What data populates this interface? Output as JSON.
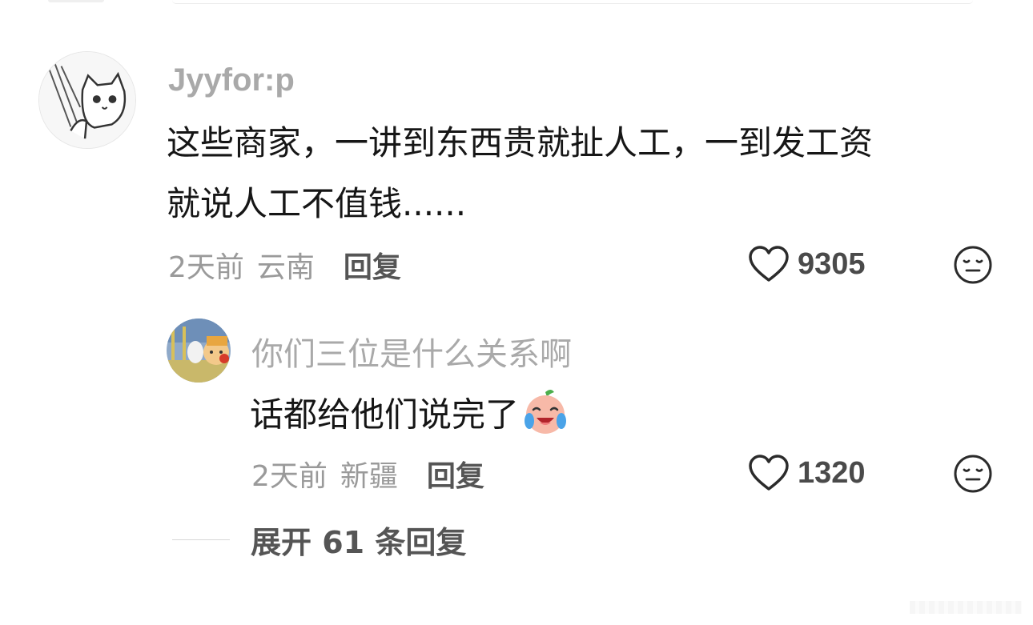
{
  "comments": [
    {
      "username": "Jyyfor:p",
      "text_lines": [
        "这些商家，一讲到东西贵就扯人工，一到发工资",
        "就说人工不值钱......"
      ],
      "time": "2天前",
      "location": "云南",
      "reply_label": "回复",
      "likes": "9305",
      "avatar_icon": "cat-sketch-avatar-icon"
    },
    {
      "username": "你们三位是什么关系啊",
      "text_lines": [
        "话都给他们说完了"
      ],
      "emoji": "laughing-crying-emoji-icon",
      "time": "2天前",
      "location": "新疆",
      "reply_label": "回复",
      "likes": "1320",
      "avatar_icon": "cartoon-avatar-icon"
    }
  ],
  "expand_label": "展开 61 条回复",
  "icons": {
    "like": "heart-outline-icon",
    "dislike": "meh-face-icon"
  },
  "colors": {
    "username": "#a9a9a9",
    "text": "#161616",
    "meta": "#9a9a9a",
    "action": "#555555"
  }
}
